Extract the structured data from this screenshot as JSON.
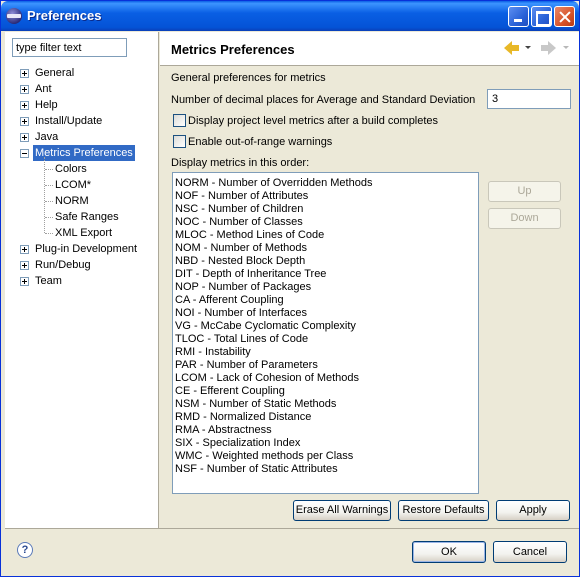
{
  "window": {
    "title": "Preferences",
    "icon": "eclipse-icon"
  },
  "sidebar": {
    "filter_value": "type filter text",
    "tree": [
      {
        "label": "General",
        "expander": "plus"
      },
      {
        "label": "Ant",
        "expander": "plus"
      },
      {
        "label": "Help",
        "expander": "plus"
      },
      {
        "label": "Install/Update",
        "expander": "plus"
      },
      {
        "label": "Java",
        "expander": "plus"
      },
      {
        "label": "Metrics Preferences",
        "expander": "minus",
        "selected": true,
        "children": [
          "Colors",
          "LCOM*",
          "NORM",
          "Safe Ranges",
          "XML Export"
        ]
      },
      {
        "label": "Plug-in Development",
        "expander": "plus"
      },
      {
        "label": "Run/Debug",
        "expander": "plus"
      },
      {
        "label": "Team",
        "expander": "plus"
      }
    ]
  },
  "main": {
    "title": "Metrics Preferences",
    "general_label": "General preferences for metrics",
    "decimal_label": "Number of decimal places for Average and Standard Deviation",
    "decimal_value": "3",
    "check_display": "Display project level metrics after a build completes",
    "check_warnings": "Enable out-of-range warnings",
    "order_label": "Display metrics in this order:",
    "metrics": [
      "NORM - Number of Overridden Methods",
      "NOF - Number of Attributes",
      "NSC - Number of Children",
      "NOC - Number of Classes",
      "MLOC - Method Lines of Code",
      "NOM - Number of Methods",
      "NBD - Nested Block Depth",
      "DIT - Depth of Inheritance Tree",
      "NOP - Number of Packages",
      "CA - Afferent Coupling",
      "NOI - Number of Interfaces",
      "VG - McCabe Cyclomatic Complexity",
      "TLOC - Total Lines of Code",
      "RMI - Instability",
      "PAR - Number of Parameters",
      "LCOM - Lack of Cohesion of Methods",
      "CE - Efferent Coupling",
      "NSM - Number of Static Methods",
      "RMD - Normalized Distance",
      "RMA - Abstractness",
      "SIX - Specialization Index",
      "WMC - Weighted methods per Class",
      "NSF - Number of Static Attributes"
    ],
    "up_label": "Up",
    "down_label": "Down",
    "erase_label": "Erase All Warnings",
    "restore_label": "Restore Defaults",
    "apply_label": "Apply"
  },
  "footer": {
    "help_glyph": "?",
    "ok_label": "OK",
    "cancel_label": "Cancel"
  }
}
